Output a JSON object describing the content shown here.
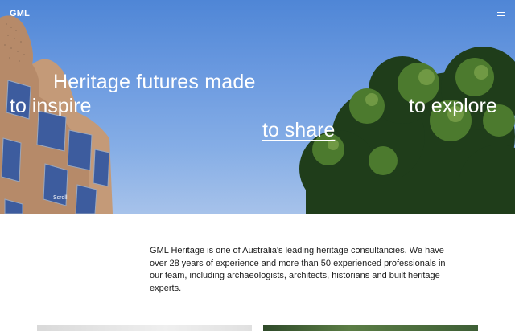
{
  "header": {
    "logo_text": "GML",
    "menu_icon": "hamburger-menu-icon"
  },
  "hero": {
    "headline": "Heritage futures made",
    "links": {
      "inspire": "to inspire",
      "share": "to share",
      "explore": "to explore"
    },
    "scroll_label": "Scroll"
  },
  "intro": {
    "text": "GML Heritage is one of Australia's leading heritage consultancies. We have over 28 years of experience and more than 50 experienced professionals in our team, including archaeologists, architects, historians and built heritage experts."
  },
  "colors": {
    "sky": "#5a8fdc",
    "text_dark": "#1a1a1a",
    "white": "#ffffff"
  }
}
